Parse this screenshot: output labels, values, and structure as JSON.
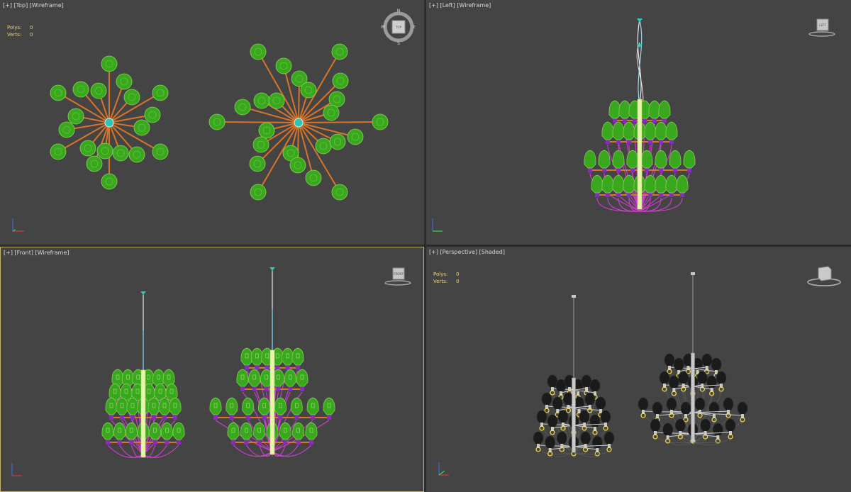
{
  "viewports": {
    "top": {
      "label_plus": "[+]",
      "label_view": "[Top]",
      "label_mode": "[Wireframe]",
      "stats": {
        "polys_label": "Polys:",
        "polys_value": "0",
        "verts_label": "Verts:",
        "verts_value": "0"
      },
      "compass": {
        "n": "N",
        "s": "S",
        "e": "E",
        "w": "W",
        "center": "TOP"
      }
    },
    "left": {
      "label_plus": "[+]",
      "label_view": "[Left]",
      "label_mode": "[Wireframe]",
      "cube_label": "LEFT"
    },
    "front": {
      "label_plus": "[+]",
      "label_view": "[Front]",
      "label_mode": "[Wireframe]",
      "cube_label": "FRONT"
    },
    "perspective": {
      "label_plus": "[+]",
      "label_view": "[Perspective]",
      "label_mode": "[Shaded]",
      "stats": {
        "polys_label": "Polys:",
        "polys_value": "0",
        "verts_label": "Verts:",
        "verts_value": "0"
      }
    }
  },
  "colors": {
    "viewport_bg": "#444444",
    "active_border": "#c8b268",
    "bulb": "#3aa81f",
    "bulb_edge": "#8cd456",
    "arm": "#d8742a",
    "hub": "#2ec4b6",
    "rod": "#e6f5a8",
    "wire": "#d23bd2",
    "joint": "#8a2bc0",
    "shaded_bulb": "#1b1b1b",
    "shaded_metal": "#c9c9c9",
    "socket_ring": "#ffe14a"
  }
}
